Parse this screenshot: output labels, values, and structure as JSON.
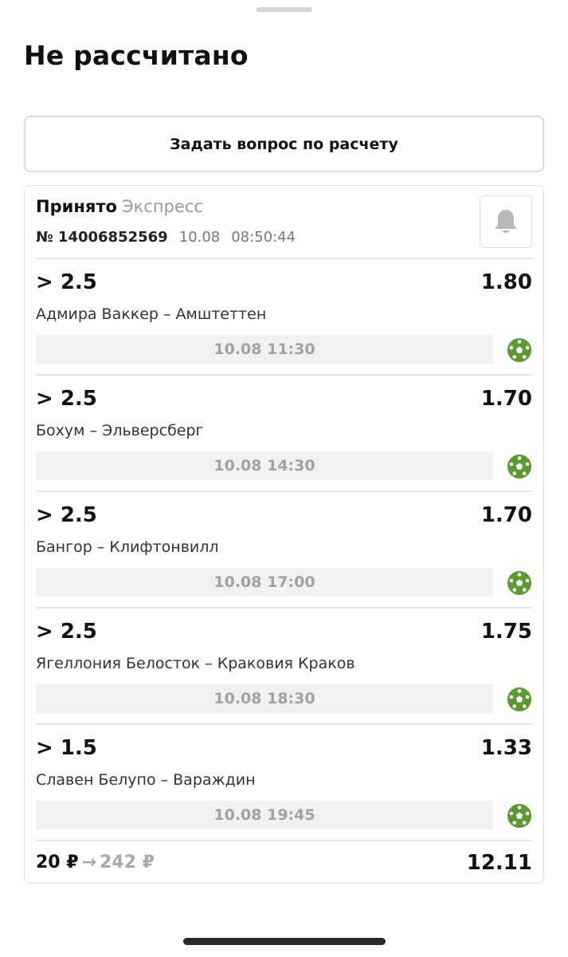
{
  "sheet": {
    "title": "Не рассчитано",
    "ask_button_label": "Задать вопрос по расчету"
  },
  "bet": {
    "status": "Принято",
    "type": "Экспресс",
    "number": "№ 14006852569",
    "date": "10.08",
    "time": "08:50:44",
    "bell_icon": "bell-icon",
    "events": [
      {
        "outcome": "> 2.5",
        "odds": "1.80",
        "teams": "Адмира Ваккер – Амштеттен",
        "start": "10.08 11:30",
        "sport_icon": "soccer-ball-icon"
      },
      {
        "outcome": "> 2.5",
        "odds": "1.70",
        "teams": "Бохум – Эльверсберг",
        "start": "10.08 14:30",
        "sport_icon": "soccer-ball-icon"
      },
      {
        "outcome": "> 2.5",
        "odds": "1.70",
        "teams": "Бангор – Клифтонвилл",
        "start": "10.08 17:00",
        "sport_icon": "soccer-ball-icon"
      },
      {
        "outcome": "> 2.5",
        "odds": "1.75",
        "teams": "Ягеллония Белосток – Краковия Краков",
        "start": "10.08 18:30",
        "sport_icon": "soccer-ball-icon"
      },
      {
        "outcome": "> 1.5",
        "odds": "1.33",
        "teams": "Славен Белупо – Вараждин",
        "start": "10.08 19:45",
        "sport_icon": "soccer-ball-icon"
      }
    ],
    "stake": "20 ₽",
    "arrow": "→",
    "potential_win": "242 ₽",
    "total_odds": "12.11"
  },
  "colors": {
    "sport_icon": "#5a9a2e",
    "muted_text": "#9a9a9a"
  }
}
